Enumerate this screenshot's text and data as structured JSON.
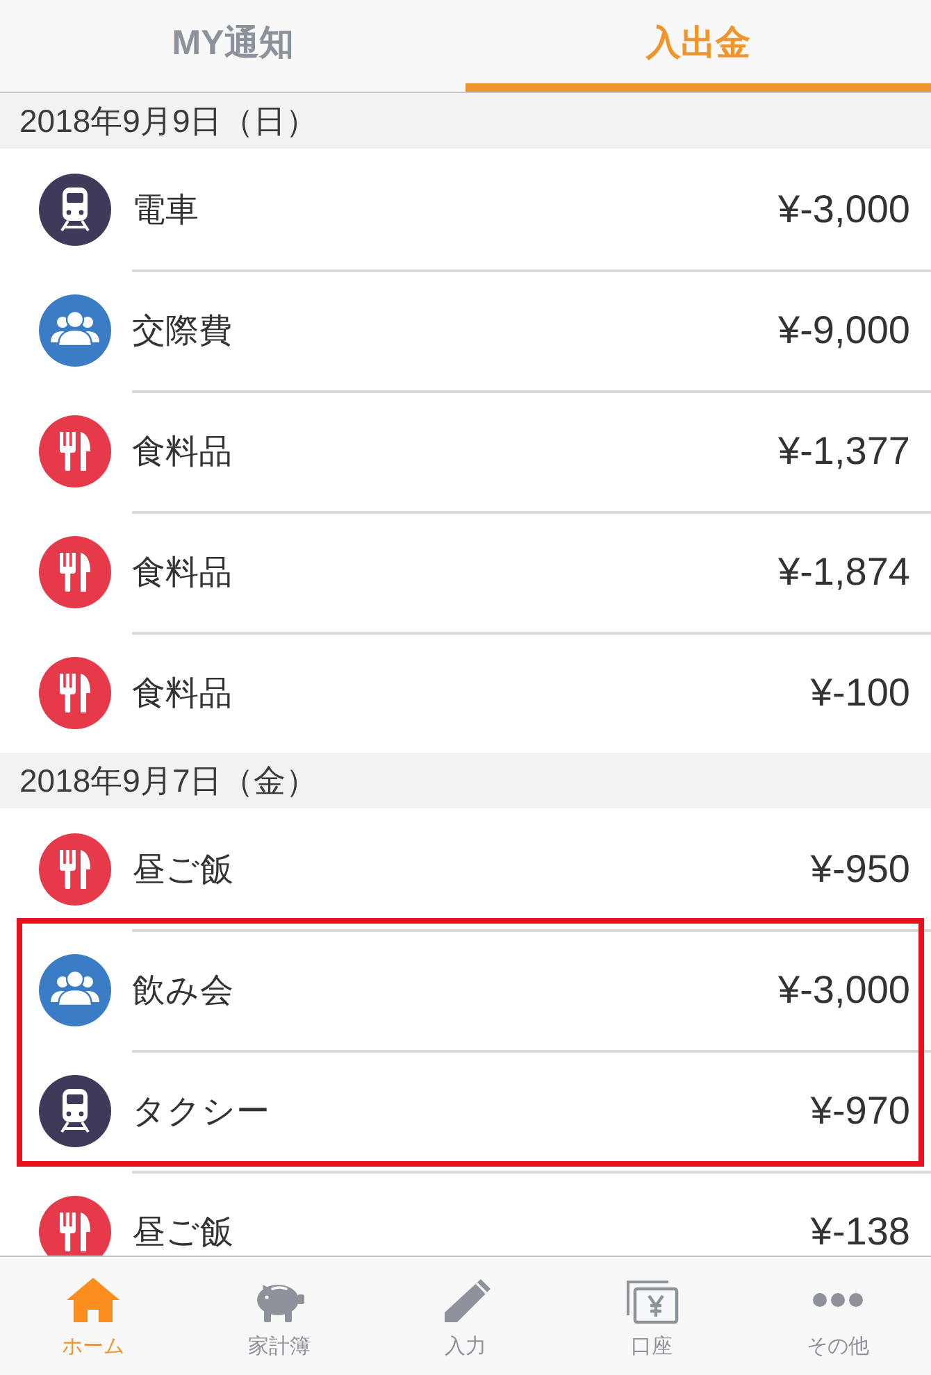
{
  "tabs": [
    {
      "label": "MY通知",
      "selected": false
    },
    {
      "label": "入出金",
      "selected": true
    }
  ],
  "sections": [
    {
      "date": "2018年9月9日（日）",
      "entries": [
        {
          "kind": "train",
          "name": "電車",
          "amount": "¥-3,000",
          "highlighted": false
        },
        {
          "kind": "people",
          "name": "交際費",
          "amount": "¥-9,000",
          "highlighted": false
        },
        {
          "kind": "food",
          "name": "食料品",
          "amount": "¥-1,377",
          "highlighted": false
        },
        {
          "kind": "food",
          "name": "食料品",
          "amount": "¥-1,874",
          "highlighted": false
        },
        {
          "kind": "food",
          "name": "食料品",
          "amount": "¥-100",
          "highlighted": false
        }
      ]
    },
    {
      "date": "2018年9月7日（金）",
      "entries": [
        {
          "kind": "food",
          "name": "昼ご飯",
          "amount": "¥-950",
          "highlighted": false
        },
        {
          "kind": "people",
          "name": "飲み会",
          "amount": "¥-3,000",
          "highlighted": true
        },
        {
          "kind": "train",
          "name": "タクシー",
          "amount": "¥-970",
          "highlighted": true
        },
        {
          "kind": "food",
          "name": "昼ご飯",
          "amount": "¥-138",
          "highlighted": false
        }
      ]
    }
  ],
  "bottom_nav": [
    {
      "label": "ホーム",
      "selected": true
    },
    {
      "label": "家計簿",
      "selected": false
    },
    {
      "label": "入力",
      "selected": false
    },
    {
      "label": "口座",
      "selected": false
    },
    {
      "label": "その他",
      "selected": false
    }
  ]
}
